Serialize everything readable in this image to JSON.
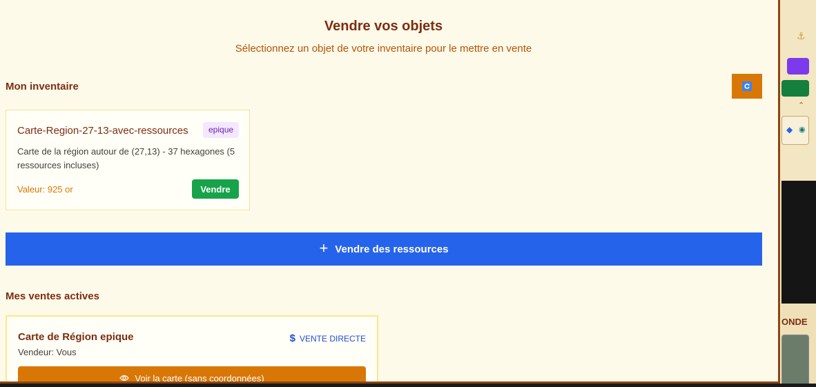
{
  "modal": {
    "title": "Vendre vos objets",
    "subtitle": "Sélectionnez un objet de votre inventaire pour le mettre en vente"
  },
  "inventory": {
    "heading": "Mon inventaire",
    "refresh_icon": "refresh-icon",
    "items": [
      {
        "name": "Carte-Region-27-13-avec-ressources",
        "rarity": "epique",
        "description": "Carte de la région autour de (27,13) - 37 hexagones (5 ressources incluses)",
        "value_label": "Valeur: 925 or",
        "sell_label": "Vendre"
      }
    ]
  },
  "sell_resources": {
    "label": "Vendre des ressources",
    "icon": "plus-icon"
  },
  "active_sales": {
    "heading": "Mes ventes actives",
    "listings": [
      {
        "title": "Carte de Région epique",
        "sale_type": "VENTE DIRECTE",
        "seller": "Vendeur: Vous",
        "view_label": "Voir la carte (sans coordonnées)"
      }
    ]
  },
  "background": {
    "partial_heading": "ONDE"
  },
  "colors": {
    "modal_bg": "#fefae9",
    "heading": "#7c2d12",
    "accent_orange": "#d97706",
    "primary_blue": "#2563eb",
    "success_green": "#16a34a",
    "rarity_purple": "#6b21a8"
  }
}
